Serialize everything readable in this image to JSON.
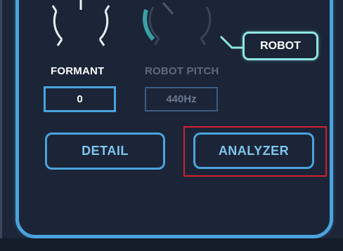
{
  "formant": {
    "label": "FORMANT",
    "value": "0",
    "knob_icon": "knob-icon"
  },
  "robot_pitch": {
    "label": "ROBOT PITCH",
    "value": "440Hz",
    "knob_icon": "knob-icon"
  },
  "robot_button": {
    "label": "ROBOT"
  },
  "buttons": {
    "detail": "DETAIL",
    "analyzer": "ANALYZER"
  },
  "colors": {
    "background": "#1d2638",
    "accent_blue": "#4aa3dc",
    "accent_teal": "#8ee5e4",
    "highlight_red": "#d0202a",
    "disabled_text": "#5f6a7e"
  }
}
